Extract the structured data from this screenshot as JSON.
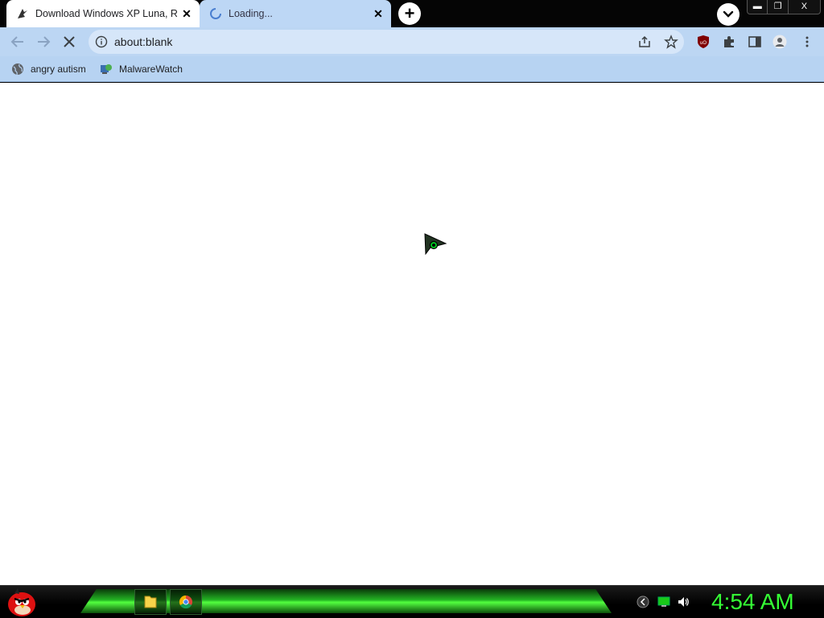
{
  "browser": {
    "tabs": [
      {
        "title": "Download Windows XP Luna, Ro",
        "state": "active",
        "favicon": "pen-nib-icon"
      },
      {
        "title": "Loading...",
        "state": "loading",
        "favicon": "spinner-icon"
      }
    ],
    "window_controls": {
      "minimize": "▬",
      "restore": "❐",
      "close": "X"
    },
    "toolbar": {
      "url": "about:blank"
    },
    "bookmarks": [
      {
        "label": "angry autism",
        "icon": "globe-icon"
      },
      {
        "label": "MalwareWatch",
        "icon": "malwarewatch-icon"
      }
    ]
  },
  "taskbar": {
    "clock": "4:54 AM",
    "pinned": [
      "folder-icon",
      "chrome-icon"
    ],
    "tray": [
      "kaspersky-icon",
      "network-icon",
      "volume-icon"
    ]
  },
  "colors": {
    "tab_strip": "#050505",
    "toolbar": "#bcd6f3",
    "omnibox": "#d6e6f9",
    "clock": "#35ff35",
    "taskbar_green": "#23b323"
  }
}
